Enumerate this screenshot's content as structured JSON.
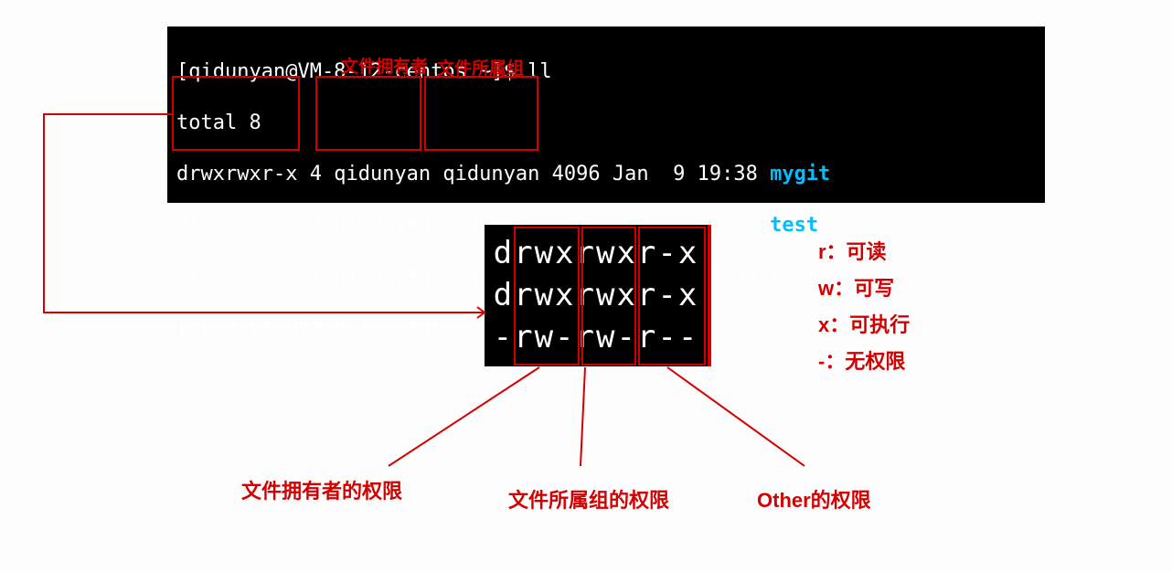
{
  "terminal": {
    "prompt": "[qidunyan@VM-8-12-centos ~]$",
    "cmd": "ll",
    "total": "total 8",
    "rows": [
      {
        "perm": "drwxrwxr-x",
        "links": "4",
        "owner": "qidunyan",
        "group": "qidunyan",
        "size": "4096",
        "date": "Jan  9 19:38",
        "name": "mygit",
        "isdir": true
      },
      {
        "perm": "drwxrwxr-x",
        "links": "3",
        "owner": "qidunyan",
        "group": "qidunyan",
        "size": "4096",
        "date": "Jan  8 20:22",
        "name": "test",
        "isdir": true
      },
      {
        "perm": "-rw-rw-r--",
        "links": "1",
        "owner": "qidunyan",
        "group": "qidunyan",
        "size": "0",
        "date": "Jan 27 19:49",
        "name": "test.txt",
        "isdir": false
      }
    ]
  },
  "annotations": {
    "owner_label": "文件拥有者",
    "group_label": "文件所属组"
  },
  "perm_breakdown": {
    "lines": [
      "drwxrwxr-x",
      "drwxrwxr-x",
      "-rw-rw-r--"
    ]
  },
  "legend": {
    "r": "r：可读",
    "w": "w：可写",
    "x": "x：可执行",
    "dash": "-：无权限"
  },
  "bottom_labels": {
    "owner_perm": "文件拥有者的权限",
    "group_perm": "文件所属组的权限",
    "other_perm": "Other的权限"
  }
}
